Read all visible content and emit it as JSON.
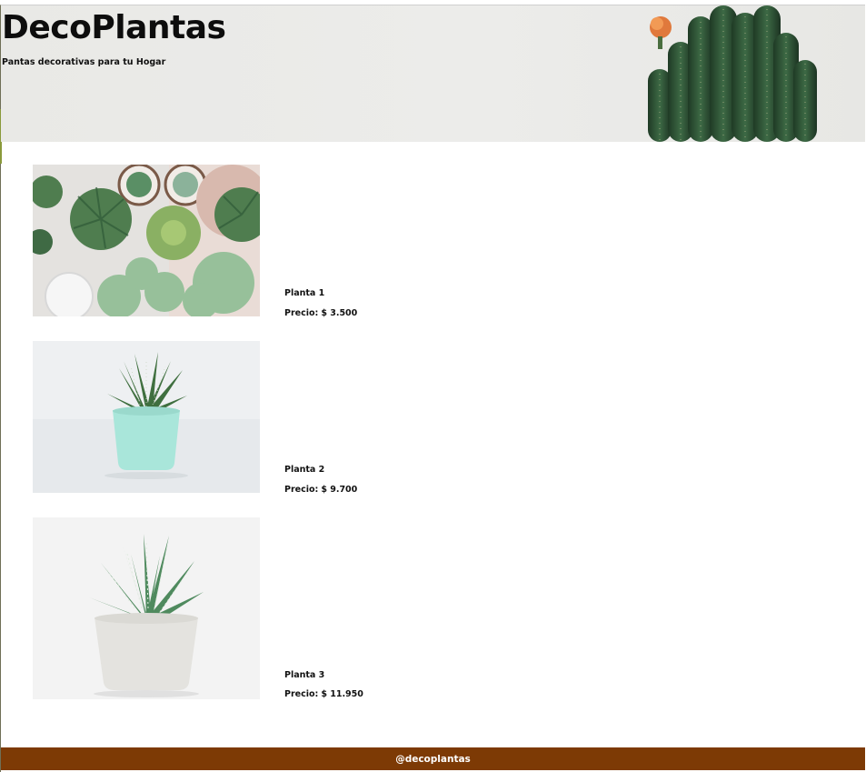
{
  "header": {
    "title": "DecoPlantas",
    "tagline": "Pantas decorativas para tu Hogar"
  },
  "products": [
    {
      "name": "Planta 1",
      "price_label": "Precio:",
      "price": "$ 3.500"
    },
    {
      "name": "Planta 2",
      "price_label": "Precio:",
      "price": "$ 9.700"
    },
    {
      "name": "Planta 3",
      "price_label": "Precio:",
      "price": "$ 11.950"
    }
  ],
  "footer": {
    "handle": "@decoplantas"
  },
  "colors": {
    "footer_bg": "#7d3a05",
    "header_bg": "#ebebe8",
    "text": "#111111"
  }
}
